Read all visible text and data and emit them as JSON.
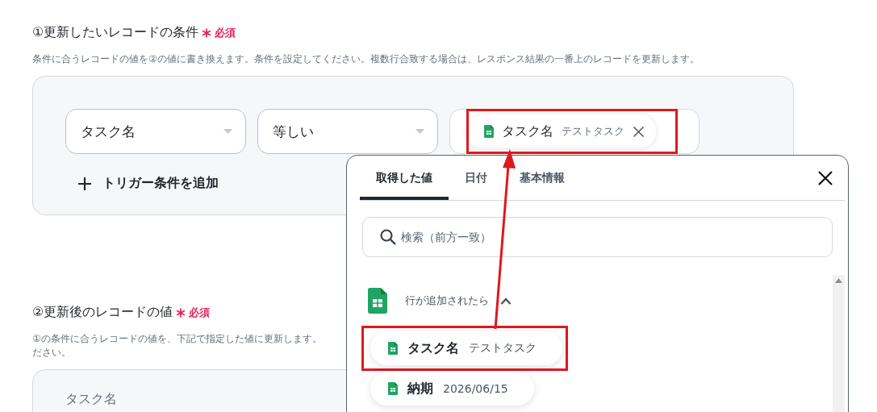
{
  "section1": {
    "title": "①更新したいレコードの条件",
    "required": "必須",
    "description": "条件に合うレコードの値を②の値に書き換えます。条件を設定してください。複数行合致する場合は、レスポンス結果の一番上のレコードを更新します。",
    "conditions": [
      {
        "field": "タスク名",
        "operator": "等しい",
        "value": {
          "name": "タスク名",
          "sample": "テストタスク",
          "highlighted": true
        }
      }
    ],
    "add_condition": "トリガー条件を追加"
  },
  "section2": {
    "title": "②更新後のレコードの値",
    "required": "必須",
    "description_lines": [
      "①の条件に合うレコードの値を、下記で指定した値に更新します。",
      "ださい。"
    ],
    "fields": [
      {
        "label": "タスク名"
      }
    ]
  },
  "popup": {
    "tabs": [
      {
        "label": "取得した値",
        "selected": true
      },
      {
        "label": "日付",
        "selected": false
      },
      {
        "label": "基本情報",
        "selected": false
      }
    ],
    "search": {
      "placeholder": "検索（前方一致）"
    },
    "group": {
      "title": "行が追加されたら",
      "expanded": true,
      "items": [
        {
          "name": "タスク名",
          "sample": "テストタスク",
          "highlighted": true
        },
        {
          "name": "納期",
          "sample": "2026/06/15",
          "highlighted": false
        }
      ]
    }
  }
}
